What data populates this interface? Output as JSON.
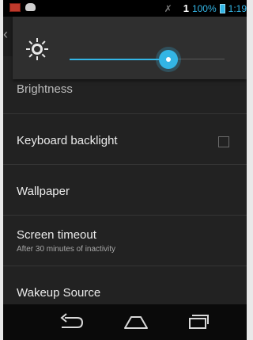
{
  "status_bar": {
    "signal": "1",
    "battery_percent": "100%",
    "time": "1:19",
    "icons": [
      "red-notification-icon",
      "android-notification-icon",
      "no-signal-icon",
      "battery-icon"
    ]
  },
  "brightness": {
    "label": "Brightness",
    "level": 0.64,
    "accent_color": "#33b5e5"
  },
  "settings": [
    {
      "title": "Keyboard backlight",
      "checkbox": false
    },
    {
      "title": "Wallpaper"
    },
    {
      "title": "Screen timeout",
      "summary": "After 30 minutes of inactivity"
    },
    {
      "title": "Wakeup Source"
    }
  ],
  "nav": [
    "back-icon",
    "home-icon",
    "recents-icon"
  ]
}
